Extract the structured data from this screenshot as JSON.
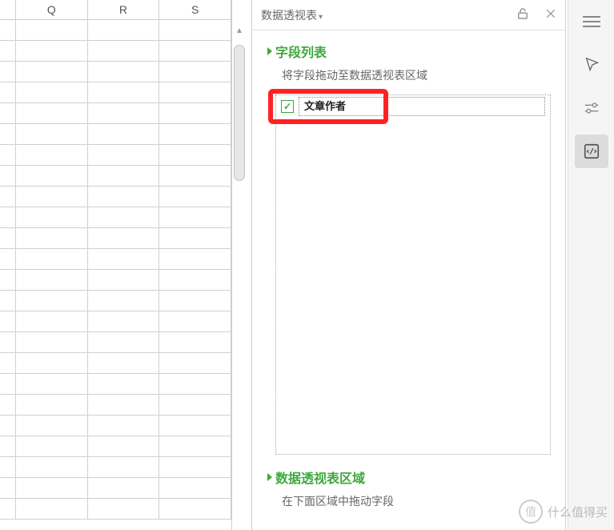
{
  "grid": {
    "columns": [
      "",
      "Q",
      "R",
      "S"
    ],
    "row_count": 24
  },
  "panel": {
    "title": "数据透视表",
    "lock_icon": "lock",
    "close_icon": "close"
  },
  "field_list": {
    "title": "字段列表",
    "hint": "将字段拖动至数据透视表区域",
    "items": [
      {
        "name": "文章作者",
        "checked": true
      }
    ]
  },
  "area_section": {
    "title": "数据透视表区域",
    "hint": "在下面区域中拖动字段"
  },
  "rail": {
    "items": [
      "menu",
      "cursor",
      "sliders",
      "swap"
    ]
  },
  "watermark": {
    "badge": "值",
    "text": "什么值得买"
  }
}
